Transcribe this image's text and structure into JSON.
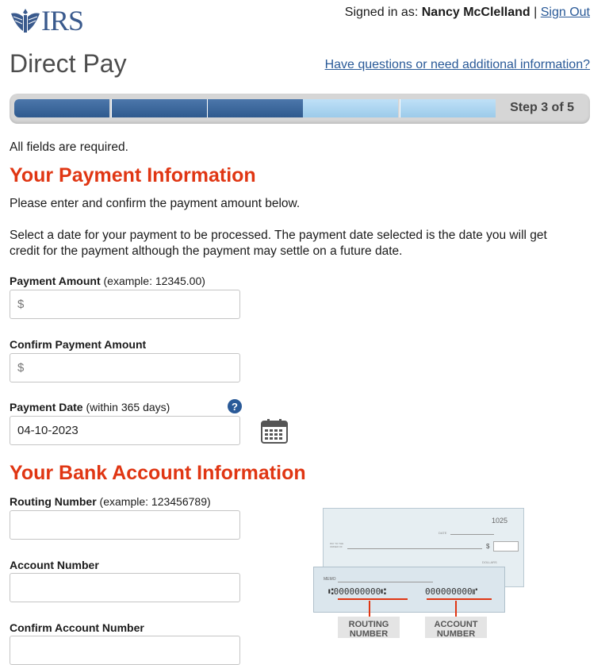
{
  "brand": {
    "logo_text": "IRS",
    "logo_icon": "eagle-seal-icon"
  },
  "session": {
    "signed_in_prefix": "Signed in as:",
    "user_name": "Nancy McClelland",
    "separator": "|",
    "sign_out": "Sign Out"
  },
  "header": {
    "title": "Direct Pay",
    "help_link": "Have questions or need additional information?"
  },
  "progress": {
    "step_label": "Step 3 of 5",
    "current_step": 3,
    "total_steps": 5
  },
  "form": {
    "required_note": "All fields are required.",
    "payment_section": {
      "heading": "Your Payment Information",
      "intro": "Please enter and confirm the payment amount below.",
      "date_note": "Select a date for your payment to be processed. The payment date selected is the date you will get credit for the payment although the payment may settle on a future date.",
      "amount_label": "Payment Amount",
      "amount_hint": "(example: 12345.00)",
      "amount_placeholder": "$",
      "confirm_amount_label": "Confirm Payment Amount",
      "confirm_amount_placeholder": "$",
      "date_label": "Payment Date",
      "date_hint": "(within 365 days)",
      "date_value": "04-10-2023",
      "help_icon_text": "?",
      "calendar_icon": "calendar-icon"
    },
    "bank_section": {
      "heading": "Your Bank Account Information",
      "routing_label": "Routing Number",
      "routing_hint": "(example: 123456789)",
      "account_label": "Account Number",
      "confirm_account_label": "Confirm Account Number"
    }
  },
  "check_image": {
    "check_number": "1025",
    "memo": "MEMO",
    "date_label": "DATE",
    "dollars_label": "DOLLARS",
    "pay_label": "PAY TO THE ORDER OF",
    "dollar_sign": "$",
    "routing_digits": "⑆000000000⑆",
    "account_digits": "000000000⑈",
    "routing_tag": "ROUTING NUMBER",
    "account_tag": "ACCOUNT NUMBER",
    "accent_color": "#e03613"
  },
  "colors": {
    "accent": "#e03613",
    "link": "#2a5a98",
    "progress_done": "#3a6399",
    "progress_todo": "#b3d8f2"
  }
}
